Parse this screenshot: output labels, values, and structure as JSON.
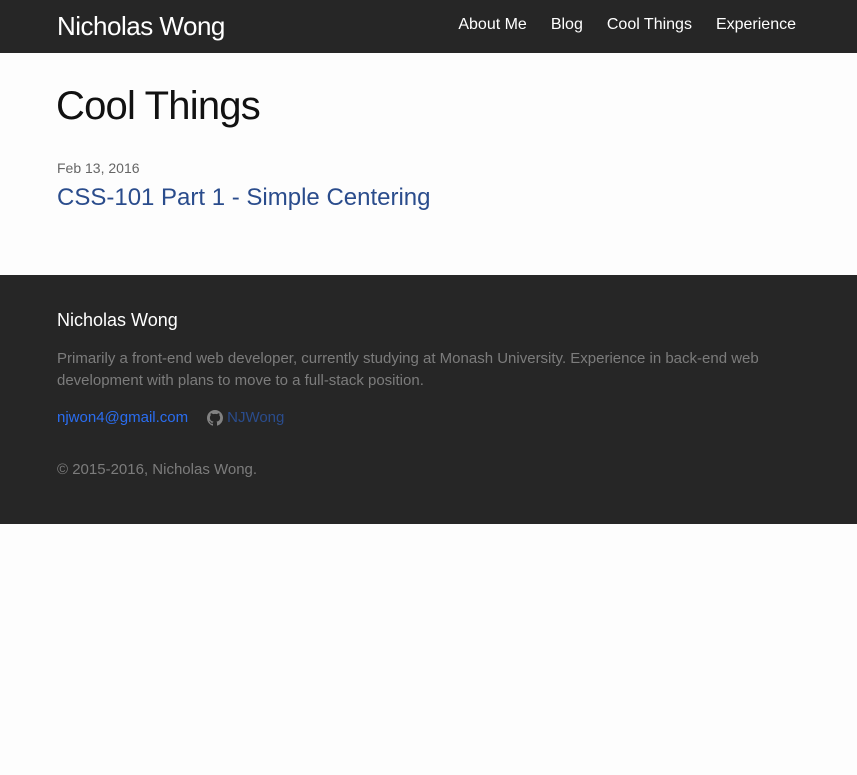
{
  "header": {
    "site_title": "Nicholas Wong",
    "nav": [
      {
        "label": "About Me"
      },
      {
        "label": "Blog"
      },
      {
        "label": "Cool Things"
      },
      {
        "label": "Experience"
      }
    ]
  },
  "main": {
    "heading": "Cool Things",
    "posts": [
      {
        "date": "Feb 13, 2016",
        "title": "CSS-101 Part 1 - Simple Centering"
      }
    ]
  },
  "footer": {
    "heading": "Nicholas Wong",
    "description": "Primarily a front-end web developer, currently studying at Monash University. Experience in back-end web development with plans to move to a full-stack position.",
    "email": "njwon4@gmail.com",
    "github": {
      "icon": "github-icon",
      "label": "NJWong"
    },
    "copyright": "© 2015-2016, Nicholas Wong."
  },
  "colors": {
    "header_bg": "#262626",
    "page_bg": "#fdfdfd",
    "link": "#2a4c8c",
    "email_link": "#2a6df0",
    "muted_text": "#7c7c7c"
  }
}
